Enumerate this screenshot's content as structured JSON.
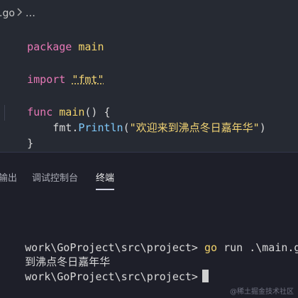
{
  "editor": {
    "breadcrumb": {
      "file": ".go",
      "separator": "…"
    },
    "code": {
      "line1": {
        "kw": "package",
        "name": "main"
      },
      "line2": {
        "kw": "import",
        "str": "\"fmt\""
      },
      "line3": {
        "kw": "func",
        "fn": "main",
        "rest": "() {"
      },
      "line4": {
        "pkg": "    fmt.",
        "method": "Println",
        "open": "(",
        "str": "\"欢迎来到沸点冬日嘉年华\"",
        "close": ")"
      },
      "line5": {
        "text": "}"
      }
    }
  },
  "panel": {
    "tabs": [
      {
        "label": "输出",
        "active": false
      },
      {
        "label": "调试控制台",
        "active": false
      },
      {
        "label": "终端",
        "active": true
      }
    ],
    "terminal": {
      "line1_prompt": "work\\GoProject\\src\\project> ",
      "line1_cmd": "go",
      "line1_args": " run .\\main.go",
      "line2_output": "到沸点冬日嘉年华",
      "line3_prompt": "work\\GoProject\\src\\project>"
    },
    "watermark": "@稀土掘金技术社区"
  }
}
